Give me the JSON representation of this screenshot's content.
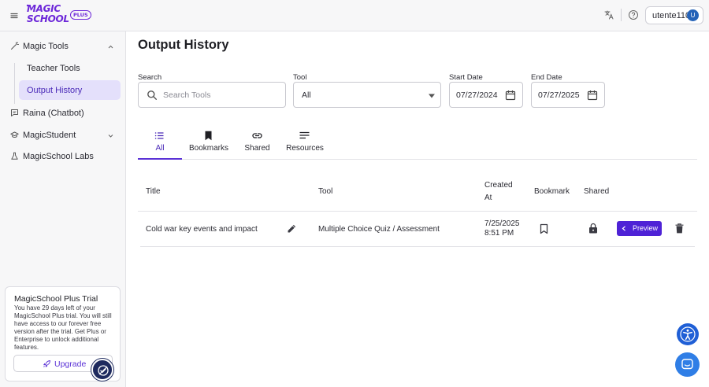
{
  "header": {
    "logo_line1": "MAGIC",
    "logo_line2": "SCHOOL",
    "logo_badge": "PLUS",
    "user_name": "utente110",
    "user_initial": "U"
  },
  "sidebar": {
    "magic_tools": "Magic Tools",
    "teacher_tools": "Teacher Tools",
    "output_history": "Output History",
    "raina": "Raina (Chatbot)",
    "magicstudent": "MagicStudent",
    "labs": "MagicSchool Labs",
    "trial": {
      "title": "MagicSchool Plus Trial",
      "body": "You have 29 days left of your MagicSchool Plus trial. You will still have access to our forever free version after the trial. Get Plus or Enterprise to unlock additional features.",
      "upgrade_label": "Upgrade"
    }
  },
  "main": {
    "title": "Output History",
    "filters": {
      "search_label": "Search",
      "search_placeholder": "Search Tools",
      "tool_label": "Tool",
      "tool_value": "All",
      "start_label": "Start Date",
      "start_value": "07/27/2024",
      "end_label": "End Date",
      "end_value": "07/27/2025"
    },
    "tabs": [
      {
        "label": "All",
        "icon": "list-icon"
      },
      {
        "label": "Bookmarks",
        "icon": "bookmark-icon"
      },
      {
        "label": "Shared",
        "icon": "link-icon"
      },
      {
        "label": "Resources",
        "icon": "notes-icon"
      }
    ],
    "table": {
      "headers": {
        "title": "Title",
        "tool": "Tool",
        "created_line1": "Created",
        "created_line2": "At",
        "bookmark": "Bookmark",
        "shared": "Shared"
      },
      "rows": [
        {
          "title": "Cold war key events and impact",
          "tool": "Multiple Choice Quiz / Assessment",
          "date": "7/25/2025",
          "time": "8:51 PM",
          "preview_label": "Preview"
        }
      ]
    }
  },
  "colors": {
    "accent": "#5b32d6",
    "active_nav_bg": "#e4e0fb",
    "avatar": "#2563b8",
    "a11y": "#1f5fd6"
  }
}
